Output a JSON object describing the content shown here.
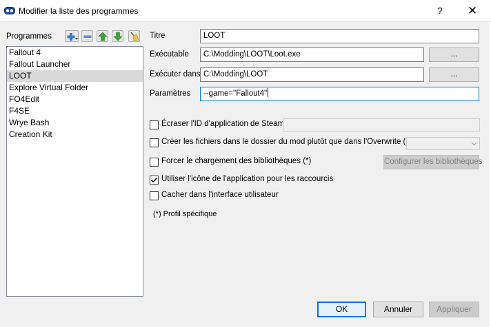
{
  "window": {
    "title": "Modifier la liste des programmes",
    "help_label": "?",
    "close_label": "✕"
  },
  "programs": {
    "label": "Programmes",
    "items": [
      "Fallout 4",
      "Fallout Launcher",
      "LOOT",
      "Explore Virtual Folder",
      "FO4Edit",
      "F4SE",
      "Wrye Bash",
      "Creation Kit"
    ],
    "selected_index": 2,
    "toolbar_icons": [
      "add-icon",
      "remove-icon",
      "move-up-icon",
      "move-down-icon",
      "clean-broom-icon"
    ]
  },
  "form": {
    "title_label": "Titre",
    "title_value": "LOOT",
    "executable_label": "Exécutable",
    "executable_value": "C:\\Modding\\LOOT\\Loot.exe",
    "start_in_label": "Exécuter dans",
    "start_in_value": "C:\\Modding\\LOOT",
    "args_label": "Paramètres",
    "args_value": "--game=\"Fallout4\"",
    "browse_label": "..."
  },
  "options": {
    "steam_id_label": "Écraser l'ID d'application de Steam",
    "steam_id_checked": false,
    "create_files_label": "Créer les fichiers dans le dossier du mod plutôt que dans l'Overwrite (*)",
    "create_files_checked": false,
    "force_libs_label": "Forcer le chargement des bibliothèques (*)",
    "force_libs_checked": false,
    "configure_libs_label": "Configurer les bibliothèques",
    "use_icon_label": "Utiliser l'icône de l'application pour les raccourcis",
    "use_icon_checked": true,
    "hide_ui_label": "Cacher dans l'interface utilisateur",
    "hide_ui_checked": false,
    "note": "(*) Profil spécifique"
  },
  "buttons": {
    "ok": "OK",
    "cancel": "Annuler",
    "apply": "Appliquer"
  },
  "colors": {
    "accent": "#0078d7",
    "selection": "#d9d9d9"
  }
}
